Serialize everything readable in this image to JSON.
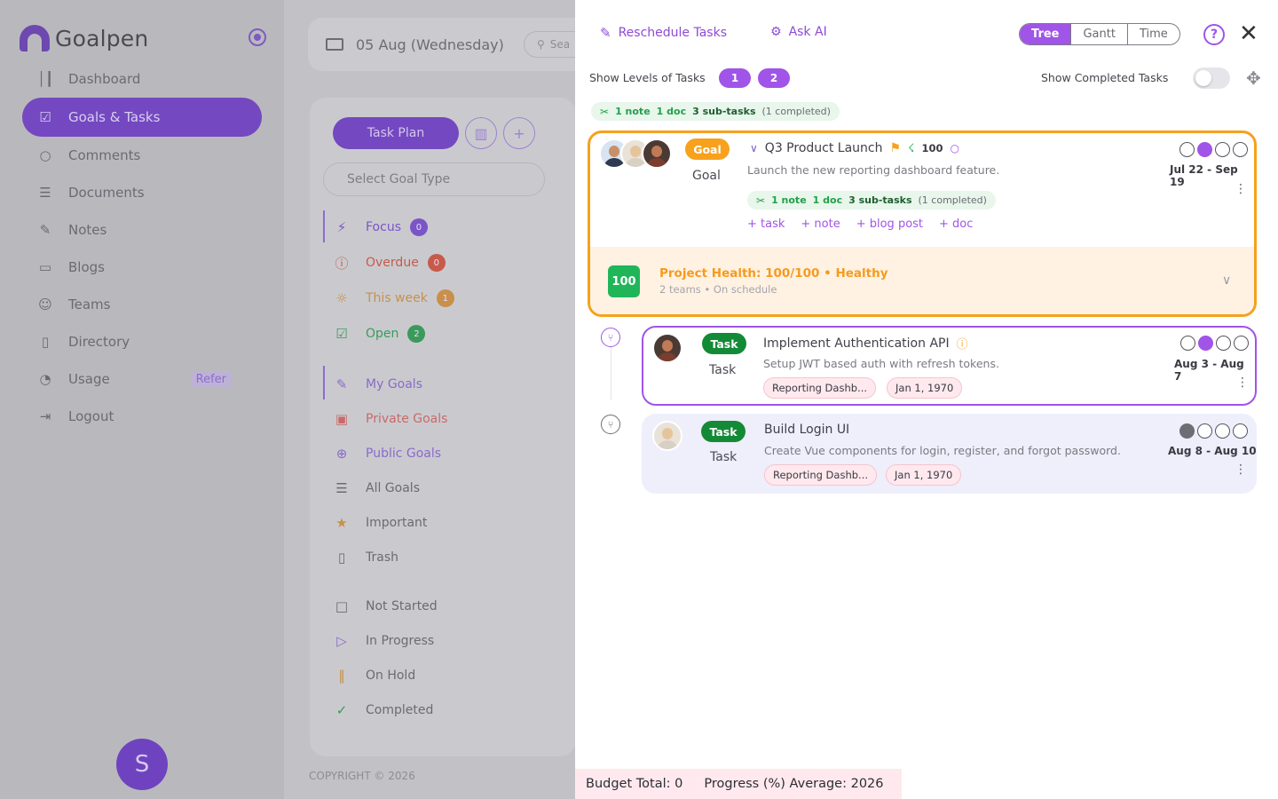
{
  "app": {
    "name": "Goalpen",
    "nav": [
      {
        "label": "Dashboard",
        "icon": "bar-chart-icon"
      },
      {
        "label": "Goals & Tasks",
        "icon": "checkbox-icon",
        "active": true
      },
      {
        "label": "Comments",
        "icon": "comment-icon"
      },
      {
        "label": "Documents",
        "icon": "document-icon"
      },
      {
        "label": "Notes",
        "icon": "feather-icon"
      },
      {
        "label": "Blogs",
        "icon": "book-icon"
      },
      {
        "label": "Teams",
        "icon": "users-icon"
      },
      {
        "label": "Directory",
        "icon": "bookmark-icon"
      },
      {
        "label": "Usage",
        "icon": "pie-icon",
        "badge": "Refer"
      },
      {
        "label": "Logout",
        "icon": "logout-icon"
      }
    ],
    "user_initial": "S",
    "copyright": "COPYRIGHT © 2026"
  },
  "main": {
    "date": "05 Aug (Wednesday)",
    "search_placeholder": "Sea",
    "task_plan_label": "Task Plan",
    "goal_type_placeholder": "Select Goal Type",
    "filters": [
      {
        "label": "Focus",
        "count": "0",
        "color": "#7a55c8"
      },
      {
        "label": "Overdue",
        "count": "0",
        "color": "#c85a4a"
      },
      {
        "label": "This week",
        "count": "1",
        "color": "#c8904a"
      },
      {
        "label": "Open",
        "count": "2",
        "color": "#3a9a5a"
      }
    ],
    "goal_lists": [
      {
        "label": "My Goals",
        "color": "#8a6acb"
      },
      {
        "label": "Private Goals",
        "color": "#c86a6a"
      },
      {
        "label": "Public Goals",
        "color": "#8a6acb"
      },
      {
        "label": "All Goals",
        "color": "#6a6a73"
      },
      {
        "label": "Important",
        "color": "#6a6a73"
      },
      {
        "label": "Trash",
        "color": "#6a6a73"
      }
    ],
    "statuses": [
      {
        "label": "Not Started"
      },
      {
        "label": "In Progress"
      },
      {
        "label": "On Hold"
      },
      {
        "label": "Completed"
      }
    ]
  },
  "drawer": {
    "reschedule_label": "Reschedule Tasks",
    "ask_ai_label": "Ask AI",
    "view_modes": [
      "Tree",
      "Gantt",
      "Time"
    ],
    "active_view": "Tree",
    "levels_label": "Show Levels of Tasks",
    "levels": [
      "1",
      "2"
    ],
    "show_completed_label": "Show Completed Tasks",
    "show_completed": false,
    "summary": {
      "notes": "1 note",
      "docs": "1 doc",
      "subtasks": "3 sub-tasks",
      "completed": "(1 completed)"
    },
    "goal": {
      "badge": "Goal",
      "type_label": "Goal",
      "title": "Q3 Product Launch",
      "score": "100",
      "description": "Launch the new reporting dashboard feature.",
      "summary": {
        "notes": "1 note",
        "docs": "1 doc",
        "subtasks": "3 sub-tasks",
        "completed": "(1 completed)"
      },
      "dates": "Jul 22 - Sep 19",
      "add_links": [
        "+ task",
        "+ note",
        "+ blog post",
        "+ doc"
      ],
      "health_score": "100",
      "health_title": "Project Health: 100/100 • Healthy",
      "health_sub": "2 teams • On schedule",
      "status_level": 2
    },
    "tasks": [
      {
        "badge": "Task",
        "type_label": "Task",
        "title": "Implement Authentication API",
        "description": "Setup JWT based auth with refresh tokens.",
        "chip_goal": "Reporting Dashb...",
        "chip_date": "Jan 1, 1970",
        "dates": "Aug 3 - Aug 7",
        "status_level": 2
      },
      {
        "badge": "Task",
        "type_label": "Task",
        "title": "Build Login UI",
        "description": "Create Vue components for login, register, and forgot password.",
        "chip_goal": "Reporting Dashb...",
        "chip_date": "Jan 1, 1970",
        "dates": "Aug 8 - Aug 10",
        "status_level": 1
      }
    ],
    "footer": {
      "budget": "Budget Total: 0",
      "progress": "Progress (%) Average: 2026"
    }
  },
  "colors": {
    "accent": "#a054e8",
    "goal_orange": "#f7a11c",
    "task_green": "#138a36",
    "health_green": "#21b55a"
  }
}
